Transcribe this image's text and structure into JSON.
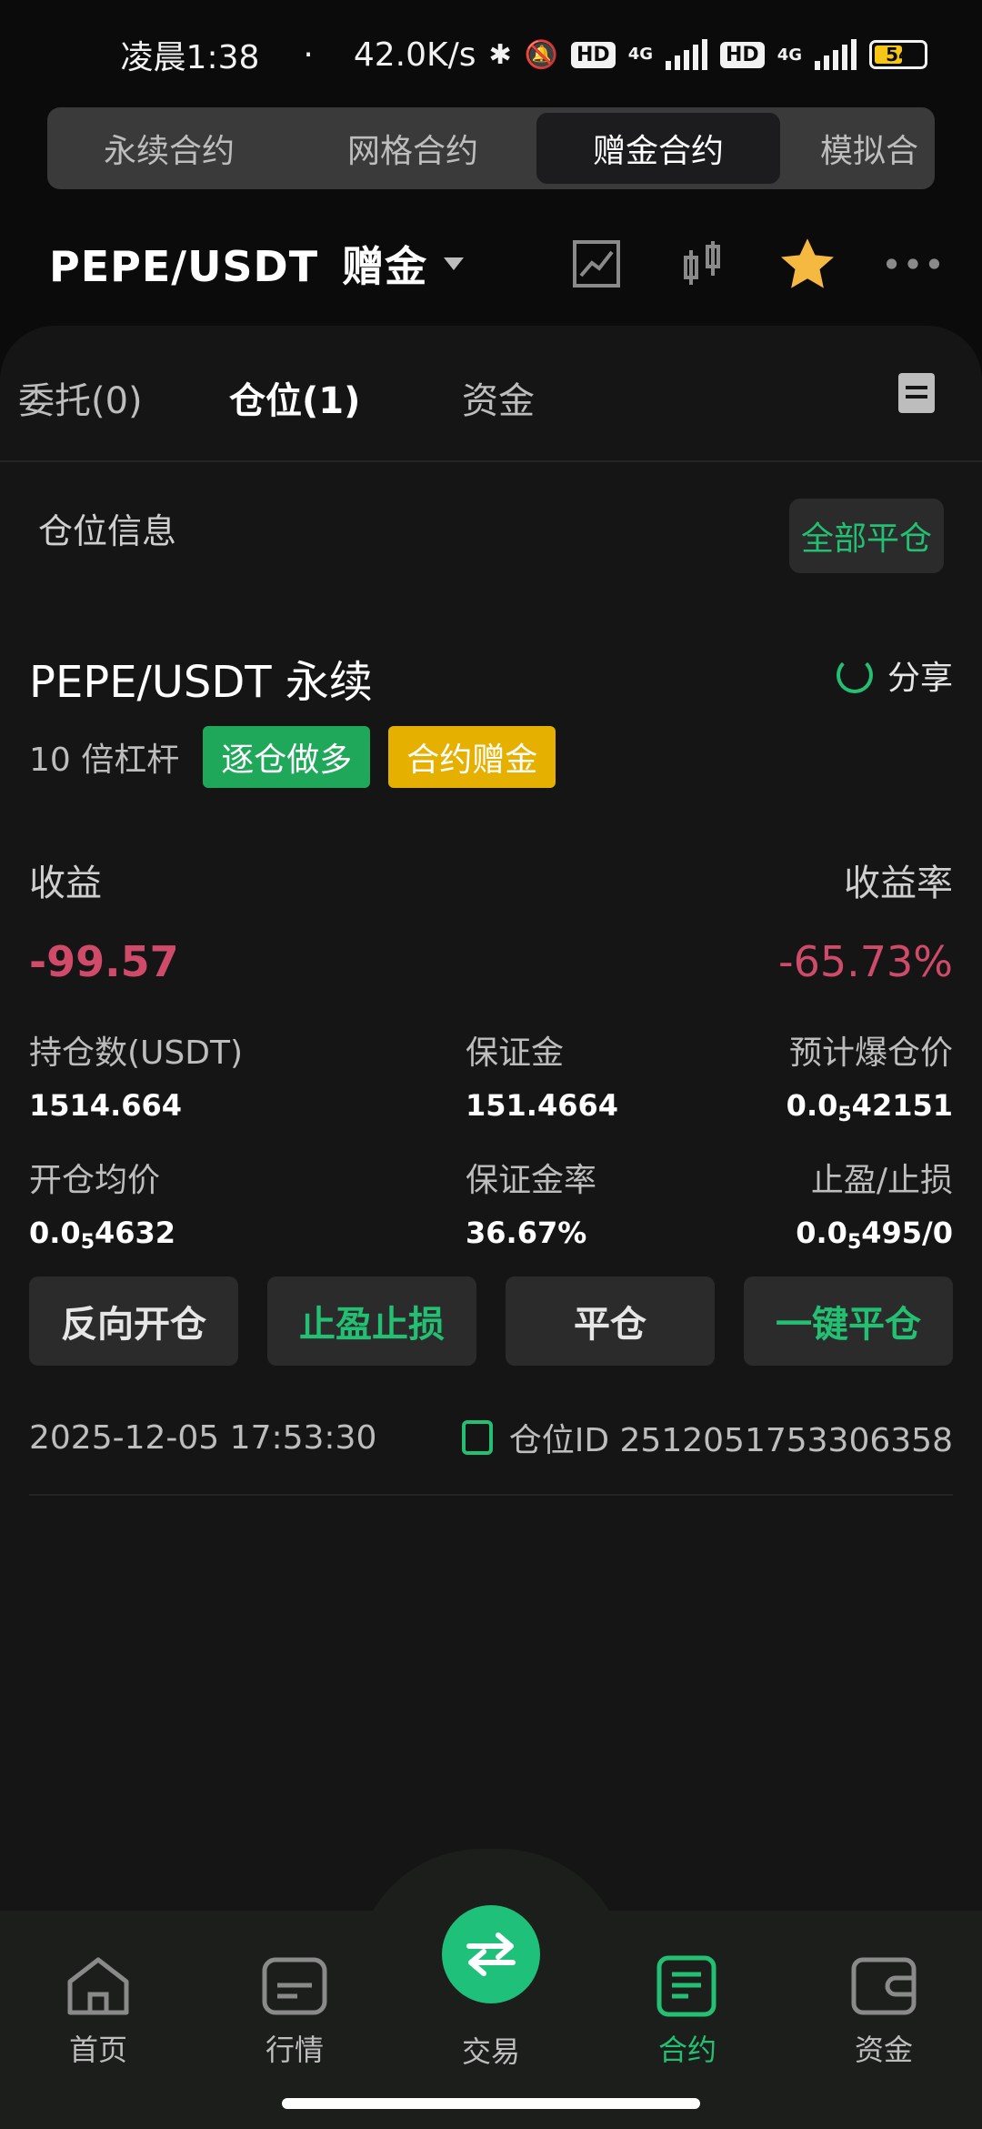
{
  "status_bar": {
    "time": "凌晨1:38",
    "dot": "·",
    "speed": "42.0K/s",
    "network1": "4G",
    "network2": "4G",
    "hd": "HD",
    "battery": "54"
  },
  "top_tabs": [
    {
      "label": "永续合约"
    },
    {
      "label": "网格合约"
    },
    {
      "label": "赠金合约",
      "active": true
    },
    {
      "label": "模拟合"
    }
  ],
  "pair_header": {
    "pair": "PEPE/USDT",
    "mode": "赠金"
  },
  "sub_tabs": [
    {
      "label": "委托(0)"
    },
    {
      "label": "仓位(1)",
      "active": true
    },
    {
      "label": "资金"
    }
  ],
  "position_section": {
    "title": "仓位信息",
    "close_all": "全部平仓"
  },
  "position": {
    "title": "PEPE/USDT 永续",
    "share": "分享",
    "leverage": "10 倍杠杆",
    "tag_side": "逐仓做多",
    "tag_bonus": "合约赠金",
    "pnl_label": "收益",
    "pnl_rate_label": "收益率",
    "pnl_value": "-99.57",
    "pnl_rate_value": "-65.73%",
    "size_label": "持仓数(USDT)",
    "size_value": "1514.664",
    "margin_label": "保证金",
    "margin_value": "151.4664",
    "liq_label": "预计爆仓价",
    "liq_prefix": "0.0",
    "liq_zeros": "5",
    "liq_digits": "42151",
    "entry_label": "开仓均价",
    "entry_prefix": "0.0",
    "entry_zeros": "5",
    "entry_digits": "4632",
    "margin_rate_label": "保证金率",
    "margin_rate_value": "36.67%",
    "tpsl_label": "止盈/止损",
    "tpsl_prefix": "0.0",
    "tpsl_zeros": "5",
    "tpsl_digits": "495/0",
    "timestamp": "2025-12-05 17:53:30",
    "position_id": "仓位ID 2512051753306358"
  },
  "actions": {
    "reverse": "反向开仓",
    "tpsl": "止盈止损",
    "close": "平仓",
    "one_click_close": "一键平仓"
  },
  "bottom_nav": [
    {
      "label": "首页"
    },
    {
      "label": "行情"
    },
    {
      "label": "交易"
    },
    {
      "label": "合约",
      "active": true
    },
    {
      "label": "资金"
    }
  ],
  "colors": {
    "green": "#23c073",
    "red": "#d04a6a",
    "gold": "#e6b000",
    "star": "#f5b942"
  }
}
